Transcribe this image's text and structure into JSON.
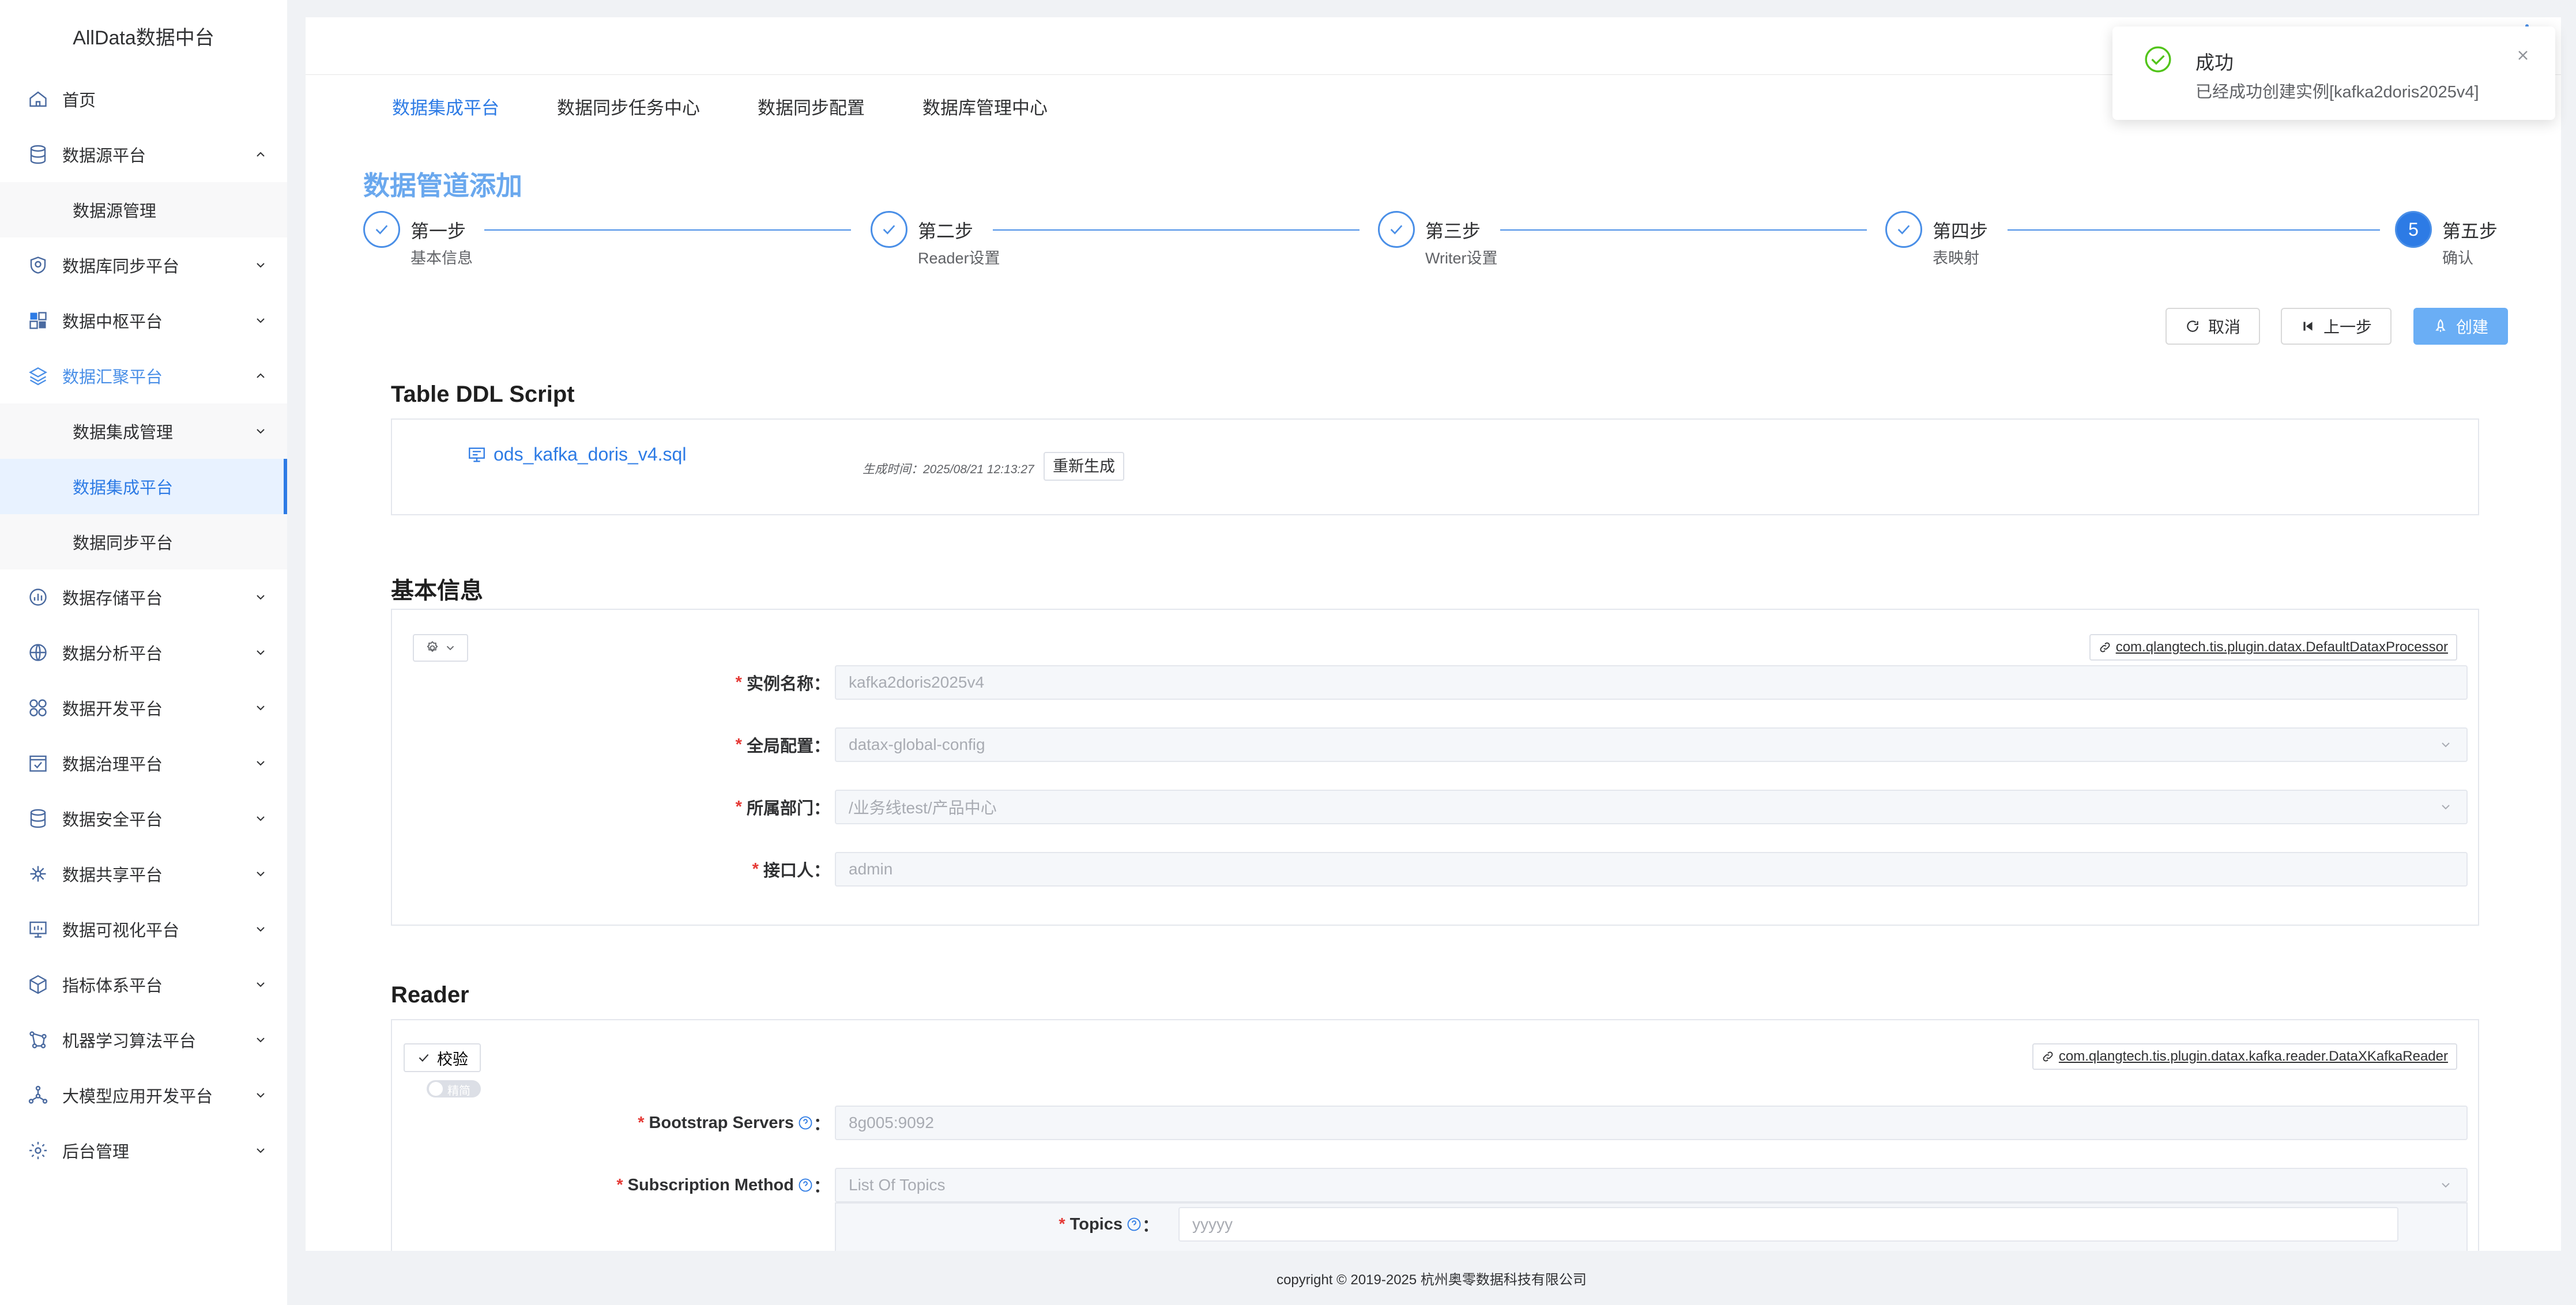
{
  "brand": "AllData数据中台",
  "sidebar": {
    "items": [
      {
        "label": "首页",
        "icon": "home-icon"
      },
      {
        "label": "数据源平台",
        "icon": "database-icon",
        "expanded": true
      },
      {
        "label": "数据源管理",
        "sub": true
      },
      {
        "label": "数据库同步平台",
        "icon": "sync-icon"
      },
      {
        "label": "数据中枢平台",
        "icon": "grid-icon"
      },
      {
        "label": "数据汇聚平台",
        "icon": "layers-icon",
        "expanded": true,
        "active": true
      },
      {
        "label": "数据集成管理",
        "sub": true
      },
      {
        "label": "数据集成平台",
        "sub": true,
        "selected": true
      },
      {
        "label": "数据同步平台",
        "sub": true
      },
      {
        "label": "数据存储平台",
        "icon": "storage-icon"
      },
      {
        "label": "数据分析平台",
        "icon": "analysis-icon"
      },
      {
        "label": "数据开发平台",
        "icon": "dev-icon"
      },
      {
        "label": "数据治理平台",
        "icon": "governance-icon"
      },
      {
        "label": "数据安全平台",
        "icon": "security-icon"
      },
      {
        "label": "数据共享平台",
        "icon": "share-icon"
      },
      {
        "label": "数据可视化平台",
        "icon": "monitor-icon"
      },
      {
        "label": "指标体系平台",
        "icon": "cube-icon"
      },
      {
        "label": "机器学习算法平台",
        "icon": "ml-icon"
      },
      {
        "label": "大模型应用开发平台",
        "icon": "llm-icon"
      },
      {
        "label": "后台管理",
        "icon": "admin-icon"
      }
    ]
  },
  "tabs": [
    "数据集成平台",
    "数据同步任务中心",
    "数据同步配置",
    "数据库管理中心"
  ],
  "page_title": "数据管道添加",
  "steps": [
    {
      "title": "第一步",
      "desc": "基本信息",
      "done": true
    },
    {
      "title": "第二步",
      "desc": "Reader设置",
      "done": true
    },
    {
      "title": "第三步",
      "desc": "Writer设置",
      "done": true
    },
    {
      "title": "第四步",
      "desc": "表映射",
      "done": true
    },
    {
      "title": "第五步",
      "desc": "确认",
      "number": "5"
    }
  ],
  "buttons": {
    "cancel": "取消",
    "prev": "上一步",
    "create": "创建"
  },
  "ddl": {
    "section_title": "Table DDL Script",
    "file": "ods_kafka_doris_v4.sql",
    "gen_time": "生成时间：2025/08/21 12:13:27",
    "regen": "重新生成"
  },
  "basic": {
    "section_title": "基本信息",
    "plugin": "com.qlangtech.tis.plugin.datax.DefaultDataxProcessor",
    "fields": [
      {
        "label": "实例名称",
        "value": "kafka2doris2025v4",
        "select": false
      },
      {
        "label": "全局配置",
        "value": "datax-global-config",
        "select": true
      },
      {
        "label": "所属部门",
        "value": "/业务线test/产品中心",
        "select": true
      },
      {
        "label": "接口人",
        "value": "admin",
        "select": false
      }
    ]
  },
  "reader": {
    "section_title": "Reader",
    "verify": "校验",
    "switch_text": "精简",
    "plugin": "com.qlangtech.tis.plugin.datax.kafka.reader.DataXKafkaReader",
    "fields": [
      {
        "label": "Bootstrap Servers",
        "value": "8g005:9092"
      },
      {
        "label": "Subscription Method",
        "value": "List Of Topics"
      },
      {
        "label": "Topics",
        "value": "yyyyy"
      }
    ]
  },
  "footer": "copyright © 2019-2025 杭州奥零数据科技有限公司",
  "toast": {
    "title": "成功",
    "message": "已经成功创建实例[kafka2doris2025v4]"
  },
  "colors": {
    "accent": "#2d7be5",
    "success": "#52c41a",
    "required": "#e53935"
  }
}
